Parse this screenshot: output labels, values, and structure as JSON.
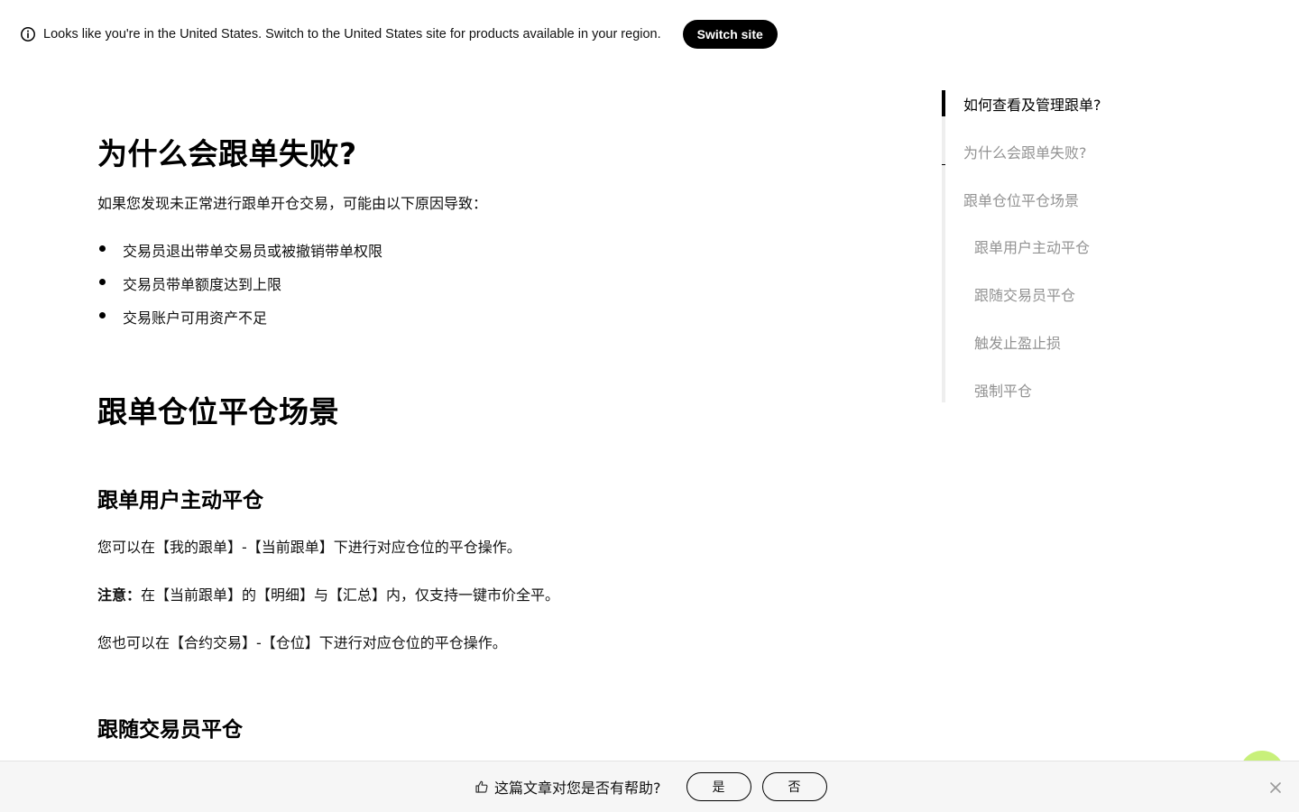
{
  "banner": {
    "icon": "info-icon",
    "text": "Looks like you're in the United States. Switch to the United States site for products available in your region.",
    "switch_label": "Switch site"
  },
  "article": {
    "section_fail": {
      "title": "为什么会跟单失败?",
      "intro": "如果您发现未正常进行跟单开仓交易，可能由以下原因导致：",
      "reasons": [
        "交易员退出带单交易员或被撤销带单权限",
        "交易员带单额度达到上限",
        "交易账户可用资产不足"
      ]
    },
    "section_close": {
      "title": "跟单仓位平仓场景"
    },
    "sub_user_close": {
      "title": "跟单用户主动平仓",
      "p1": "您可以在【我的跟单】-【当前跟单】下进行对应仓位的平仓操作。",
      "note_label": "注意：",
      "note_text": "在【当前跟单】的【明细】与【汇总】内，仅支持一键市价全平。",
      "p2": "您也可以在【合约交易】-【仓位】下进行对应仓位的平仓操作。"
    },
    "sub_follow_trader": {
      "title": "跟随交易员平仓"
    }
  },
  "toc": {
    "items": [
      {
        "label": "如何查看及管理跟单?",
        "active": true
      },
      {
        "label": "为什么会跟单失败?",
        "active": false
      },
      {
        "label": "跟单仓位平仓场景",
        "active": false
      },
      {
        "label": "跟单用户主动平仓",
        "active": false
      },
      {
        "label": "跟随交易员平仓",
        "active": false
      },
      {
        "label": "触发止盈止损",
        "active": false
      },
      {
        "label": "强制平仓",
        "active": false
      }
    ]
  },
  "feedback": {
    "icon": "thumbs-up-icon",
    "question": "这篇文章对您是否有帮助?",
    "yes": "是",
    "no": "否",
    "close_icon": "close-icon"
  },
  "colors": {
    "accent": "#000000",
    "toc_inactive": "#929292",
    "float_button": "#c8f07a",
    "feedback_bg": "#f6f6f6"
  }
}
